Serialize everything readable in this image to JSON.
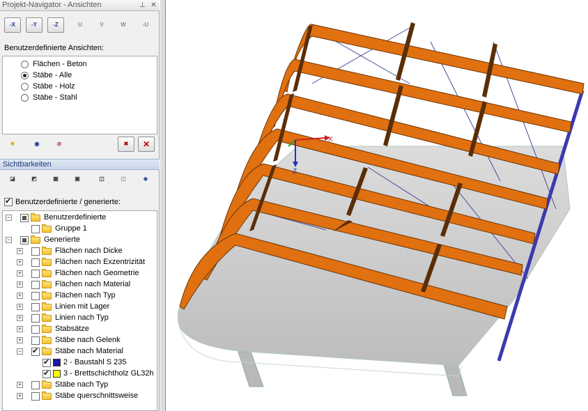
{
  "panel": {
    "title": "Projekt-Navigator - Ansichten",
    "pin_icon": "pin-icon",
    "close_icon": "close-icon"
  },
  "top_toolbar": {
    "buttons": [
      "-X",
      "-Y",
      "-Z",
      "U",
      "V",
      "W",
      "-U"
    ]
  },
  "views": {
    "label": "Benutzerdefinierte Ansichten:",
    "items": [
      {
        "label": "Flächen - Beton",
        "selected": false
      },
      {
        "label": "Stäbe - Alle",
        "selected": true
      },
      {
        "label": "Stäbe - Holz",
        "selected": false
      },
      {
        "label": "Stäbe - Stahl",
        "selected": false
      }
    ]
  },
  "view_toolbar": {
    "buttons": [
      "new-view-icon",
      "show-view-icon",
      "hide-view-icon",
      "delete-view-icon",
      "close-view-icon"
    ]
  },
  "visibility": {
    "header": "Sichtbarkeiten",
    "checkbox_label": "Benutzerdefinierte / generierte:",
    "checkbox_checked": true,
    "tree": [
      {
        "label": "Benutzerdefinierte",
        "level": 0,
        "type": "folder",
        "state": "partial",
        "expanded": true
      },
      {
        "label": "Gruppe 1",
        "level": 1,
        "type": "folder",
        "state": "unchecked"
      },
      {
        "label": "Generierte",
        "level": 0,
        "type": "folder",
        "state": "partial",
        "expanded": true
      },
      {
        "label": "Flächen nach Dicke",
        "level": 1,
        "type": "folder",
        "state": "unchecked",
        "expander": true
      },
      {
        "label": "Flächen nach Exzentrizität",
        "level": 1,
        "type": "folder",
        "state": "unchecked",
        "expander": true
      },
      {
        "label": "Flächen nach Geometrie",
        "level": 1,
        "type": "folder",
        "state": "unchecked",
        "expander": true
      },
      {
        "label": "Flächen nach Material",
        "level": 1,
        "type": "folder",
        "state": "unchecked",
        "expander": true
      },
      {
        "label": "Flächen nach Typ",
        "level": 1,
        "type": "folder",
        "state": "unchecked",
        "expander": true
      },
      {
        "label": "Linien mit Lager",
        "level": 1,
        "type": "folder",
        "state": "unchecked",
        "expander": true
      },
      {
        "label": "Linien nach Typ",
        "level": 1,
        "type": "folder",
        "state": "unchecked",
        "expander": true
      },
      {
        "label": "Stabsätze",
        "level": 1,
        "type": "folder",
        "state": "unchecked",
        "expander": true
      },
      {
        "label": "Stäbe nach Gelenk",
        "level": 1,
        "type": "folder",
        "state": "unchecked",
        "expander": true
      },
      {
        "label": "Stäbe nach Material",
        "level": 1,
        "type": "folder",
        "state": "checked",
        "expander": true,
        "expanded": true
      },
      {
        "label": "2 - Baustahl S 235",
        "level": 2,
        "type": "swatch",
        "color": "#1a1aa8",
        "state": "checked"
      },
      {
        "label": "3 - Brettschichtholz GL32h",
        "level": 2,
        "type": "swatch",
        "color": "#ffff00",
        "state": "checked"
      },
      {
        "label": "Stäbe nach Typ",
        "level": 1,
        "type": "folder",
        "state": "unchecked",
        "expander": true
      },
      {
        "label": "Stäbe querschnittsweise",
        "level": 1,
        "type": "folder",
        "state": "unchecked",
        "expander": true
      }
    ]
  },
  "viewport": {
    "axis_x": "X",
    "axis_z": "Z",
    "colors": {
      "timber": "#e07010",
      "timber_dark": "#5a2e08",
      "slab": "#c8c8c8",
      "steel": "#3a3ab0"
    }
  }
}
